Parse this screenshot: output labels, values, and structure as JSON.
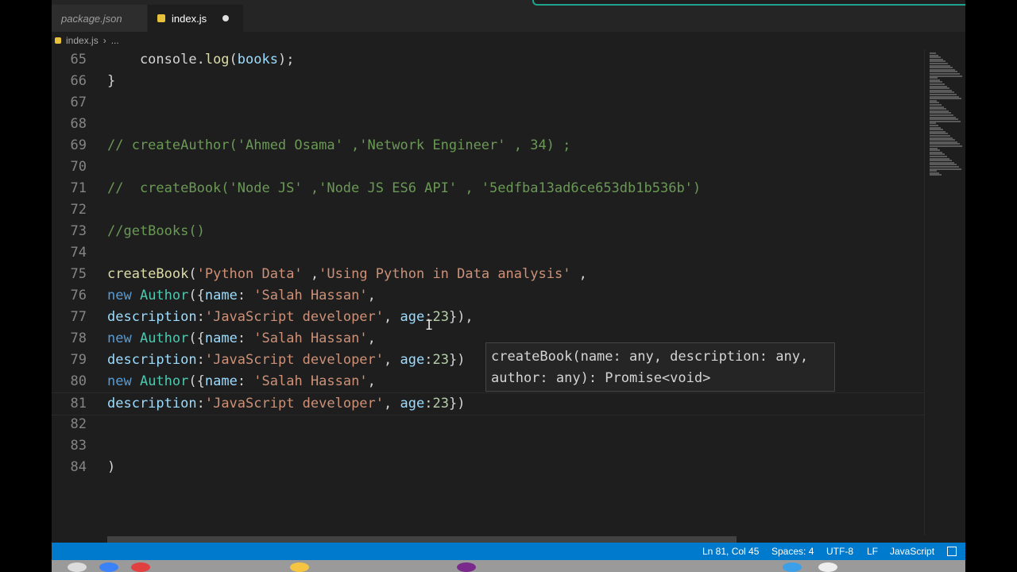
{
  "tabs": [
    {
      "label": "package.json",
      "active": false
    },
    {
      "label": "index.js",
      "active": true,
      "unsaved": true
    }
  ],
  "breadcrumb": {
    "file": "index.js",
    "more": "..."
  },
  "editor": {
    "lines": [
      {
        "n": "65",
        "tokens": [
          {
            "t": "    console.",
            "c": "pl"
          },
          {
            "t": "log",
            "c": "fn"
          },
          {
            "t": "(",
            "c": "pl"
          },
          {
            "t": "books",
            "c": "prop"
          },
          {
            "t": ");",
            "c": "pl"
          }
        ]
      },
      {
        "n": "66",
        "tokens": [
          {
            "t": "}",
            "c": "pl"
          }
        ]
      },
      {
        "n": "67",
        "tokens": []
      },
      {
        "n": "68",
        "tokens": []
      },
      {
        "n": "69",
        "tokens": [
          {
            "t": "// createAuthor('Ahmed Osama' ,'Network Engineer' , 34) ;",
            "c": "cmt"
          }
        ]
      },
      {
        "n": "70",
        "tokens": []
      },
      {
        "n": "71",
        "tokens": [
          {
            "t": "//  createBook('Node JS' ,'Node JS ES6 API' , '5edfba13ad6ce653db1b536b')",
            "c": "cmt"
          }
        ]
      },
      {
        "n": "72",
        "tokens": []
      },
      {
        "n": "73",
        "tokens": [
          {
            "t": "//getBooks()",
            "c": "cmt"
          }
        ]
      },
      {
        "n": "74",
        "tokens": []
      },
      {
        "n": "75",
        "tokens": [
          {
            "t": "createBook",
            "c": "fn"
          },
          {
            "t": "(",
            "c": "pl"
          },
          {
            "t": "'Python Data'",
            "c": "str"
          },
          {
            "t": " ,",
            "c": "pl"
          },
          {
            "t": "'Using Python in Data analysis'",
            "c": "str"
          },
          {
            "t": " ,",
            "c": "pl"
          }
        ]
      },
      {
        "n": "76",
        "tokens": [
          {
            "t": "new ",
            "c": "kw"
          },
          {
            "t": "Author",
            "c": "cls"
          },
          {
            "t": "({",
            "c": "pl"
          },
          {
            "t": "name",
            "c": "prop"
          },
          {
            "t": ": ",
            "c": "pl"
          },
          {
            "t": "'Salah Hassan'",
            "c": "str"
          },
          {
            "t": ",",
            "c": "pl"
          }
        ]
      },
      {
        "n": "77",
        "tokens": [
          {
            "t": "description",
            "c": "prop"
          },
          {
            "t": ":",
            "c": "pl"
          },
          {
            "t": "'JavaScript developer'",
            "c": "str"
          },
          {
            "t": ", ",
            "c": "pl"
          },
          {
            "t": "age",
            "c": "prop"
          },
          {
            "t": ":",
            "c": "pl"
          },
          {
            "t": "23",
            "c": "num"
          },
          {
            "t": "}),",
            "c": "pl"
          }
        ]
      },
      {
        "n": "78",
        "tokens": [
          {
            "t": "new ",
            "c": "kw"
          },
          {
            "t": "Author",
            "c": "cls"
          },
          {
            "t": "({",
            "c": "pl"
          },
          {
            "t": "name",
            "c": "prop"
          },
          {
            "t": ": ",
            "c": "pl"
          },
          {
            "t": "'Salah Hassan'",
            "c": "str"
          },
          {
            "t": ",",
            "c": "pl"
          }
        ]
      },
      {
        "n": "79",
        "tokens": [
          {
            "t": "description",
            "c": "prop"
          },
          {
            "t": ":",
            "c": "pl"
          },
          {
            "t": "'JavaScript developer'",
            "c": "str"
          },
          {
            "t": ", ",
            "c": "pl"
          },
          {
            "t": "age",
            "c": "prop"
          },
          {
            "t": ":",
            "c": "pl"
          },
          {
            "t": "23",
            "c": "num"
          },
          {
            "t": "})",
            "c": "pl"
          }
        ]
      },
      {
        "n": "80",
        "tokens": [
          {
            "t": "new ",
            "c": "kw"
          },
          {
            "t": "Author",
            "c": "cls"
          },
          {
            "t": "({",
            "c": "pl"
          },
          {
            "t": "name",
            "c": "prop"
          },
          {
            "t": ": ",
            "c": "pl"
          },
          {
            "t": "'Salah Hassan'",
            "c": "str"
          },
          {
            "t": ",",
            "c": "pl"
          }
        ]
      },
      {
        "n": "81",
        "tokens": [
          {
            "t": "description",
            "c": "prop"
          },
          {
            "t": ":",
            "c": "pl"
          },
          {
            "t": "'JavaScript developer'",
            "c": "str"
          },
          {
            "t": ", ",
            "c": "pl"
          },
          {
            "t": "age",
            "c": "prop"
          },
          {
            "t": ":",
            "c": "pl"
          },
          {
            "t": "23",
            "c": "num"
          },
          {
            "t": "})",
            "c": "pl"
          }
        ]
      },
      {
        "n": "82",
        "tokens": []
      },
      {
        "n": "83",
        "tokens": []
      },
      {
        "n": "84",
        "tokens": [
          {
            "t": ")",
            "c": "pl"
          }
        ]
      }
    ],
    "current_line": "81"
  },
  "tooltip": {
    "line1": "createBook(name: any, description: any,",
    "line2": "author: any): Promise<void>"
  },
  "statusbar": {
    "position": "Ln 81, Col 45",
    "spaces": "Spaces: 4",
    "encoding": "UTF-8",
    "eol": "LF",
    "language": "JavaScript"
  },
  "colors": {
    "editor_bg": "#1e1e1e",
    "statusbar_bg": "#007acc",
    "accent_teal": "#1fa38c"
  }
}
